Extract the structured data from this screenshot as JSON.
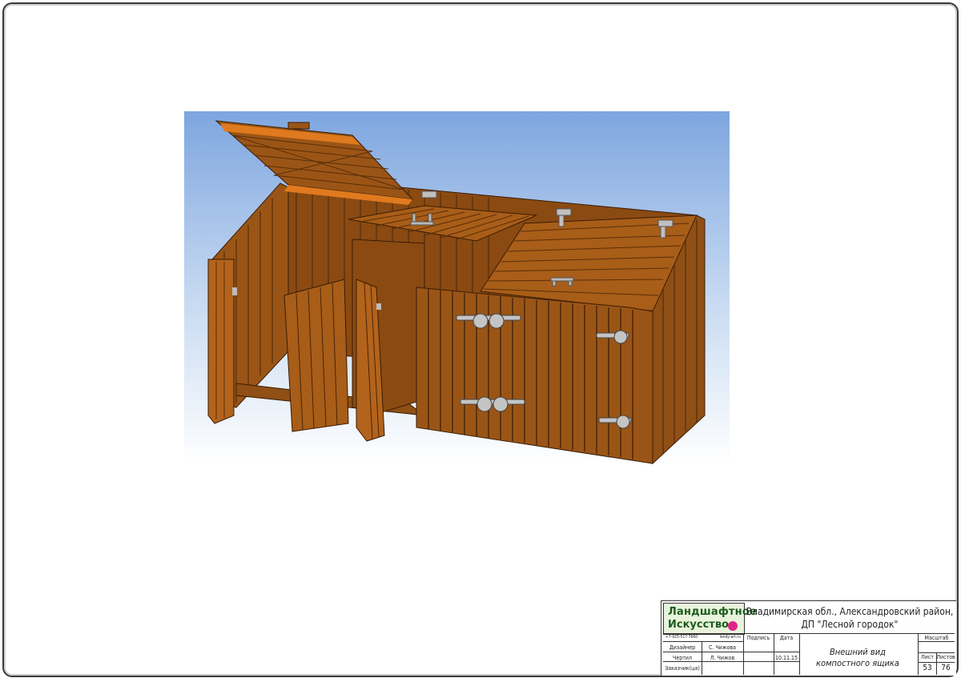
{
  "render": {
    "description_icon": "3d-render-compost-bin",
    "colors": {
      "sky_top": "#7fa7e0",
      "sky_bottom": "#ffffff",
      "wood": "#9a5516",
      "wood_dark": "#6b3a0e",
      "wood_light": "#c06a1a",
      "hinge": "#b8b8b8"
    }
  },
  "title_block": {
    "logo_line1": "Ландшафтное",
    "logo_line2": "Искусство",
    "address_line1": "Владимирская обл., Александровский район,",
    "address_line2": "ДП \"Лесной городок\"",
    "phone": "+7-925-517-7660",
    "site": "landy-art.ru",
    "header_signature": "Подпись",
    "header_date": "Дата",
    "header_scale": "Масштаб",
    "rows": [
      {
        "role": "Дизайнер",
        "name": "С. Чижова",
        "date": ""
      },
      {
        "role": "Чертил",
        "name": "Л. Чижов",
        "date": "10.11.15"
      },
      {
        "role": "Заказчик(ца)",
        "name": "",
        "date": ""
      }
    ],
    "drawing_title_line1": "Внешний вид",
    "drawing_title_line2": "компостного ящика",
    "sheet_label": "Лист",
    "sheets_label": "Листов",
    "sheet_number": "53",
    "sheets_total": "76"
  }
}
